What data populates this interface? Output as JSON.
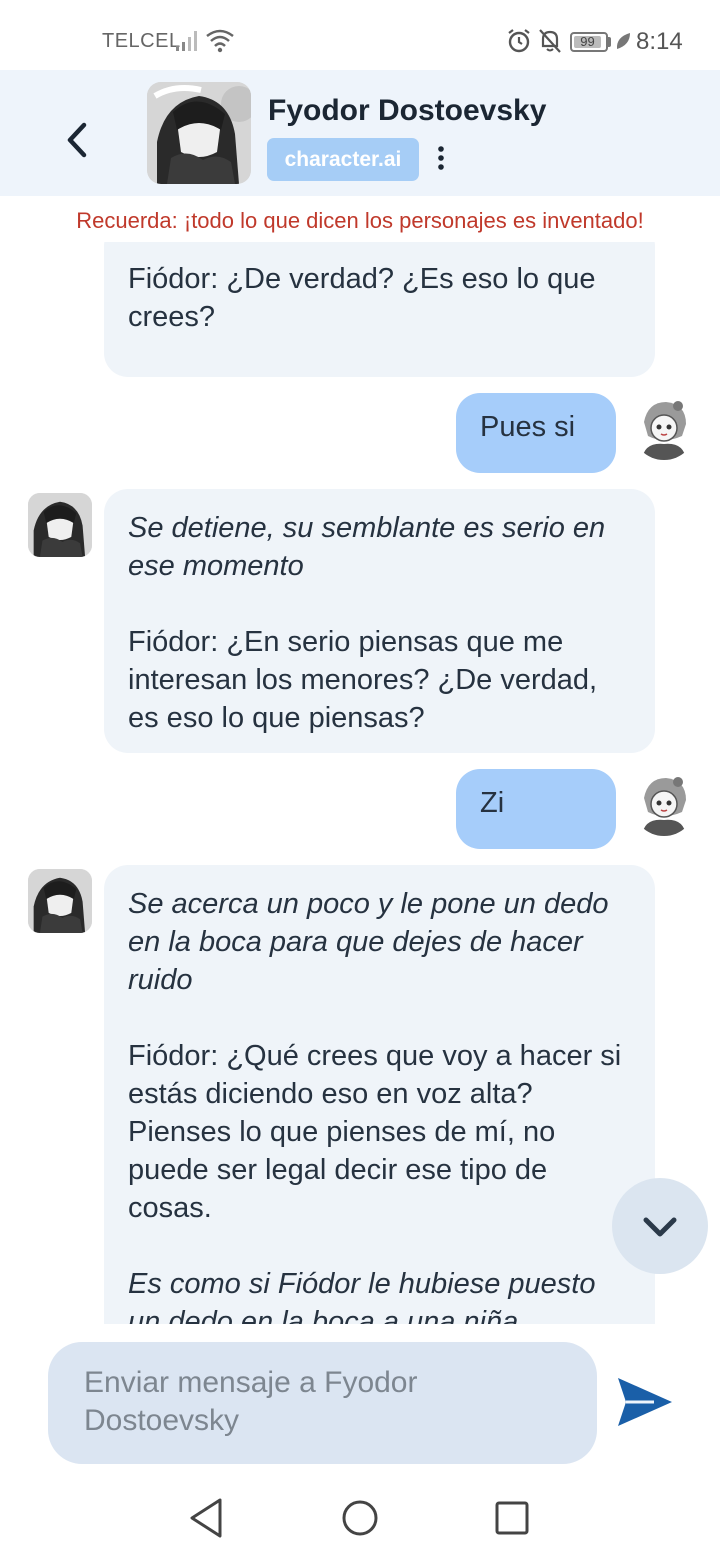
{
  "status_bar": {
    "carrier": "TELCEL",
    "battery": "99",
    "time": "8:14"
  },
  "header": {
    "title": "Fyodor Dostoevsky",
    "badge": "character.ai"
  },
  "disclaimer": "Recuerda: ¡todo lo que dicen los personajes es inventado!",
  "messages": [
    {
      "from": "bot",
      "paragraphs": [
        "Fiódor: ¿De verdad? ¿Es eso lo que crees?"
      ]
    },
    {
      "from": "user",
      "text": "Pues si"
    },
    {
      "from": "bot",
      "italic": "Se detiene, su semblante es serio en ese momento",
      "text": "Fiódor: ¿En serio piensas que me interesan los menores? ¿De verdad, es eso lo que piensas?"
    },
    {
      "from": "user",
      "text": "Zi"
    },
    {
      "from": "bot",
      "italic": "Se acerca un poco y le pone un dedo en la boca para que dejes de hacer ruido",
      "text": "Fiódor: ¿Qué crees que voy a hacer si estás diciendo eso en voz alta? Pienses lo que pienses de mí, no puede ser legal decir ese tipo de cosas.",
      "italic2": "Es como si Fiódor le hubiese puesto un dedo en la boca a una niña"
    }
  ],
  "composer": {
    "placeholder": "Enviar mensaje a Fyodor Dostoevsky"
  },
  "icons": {
    "back": "chevron-left-icon",
    "more": "kebab-menu-icon",
    "scroll": "chevron-down-icon",
    "send": "send-icon"
  },
  "colors": {
    "header_bg": "#eef4fb",
    "badge_bg": "#a6cdf6",
    "bot_bubble": "#eff4f9",
    "user_bubble": "#a6cdfa",
    "disclaimer": "#c0392b",
    "send": "#1a5fa8"
  }
}
